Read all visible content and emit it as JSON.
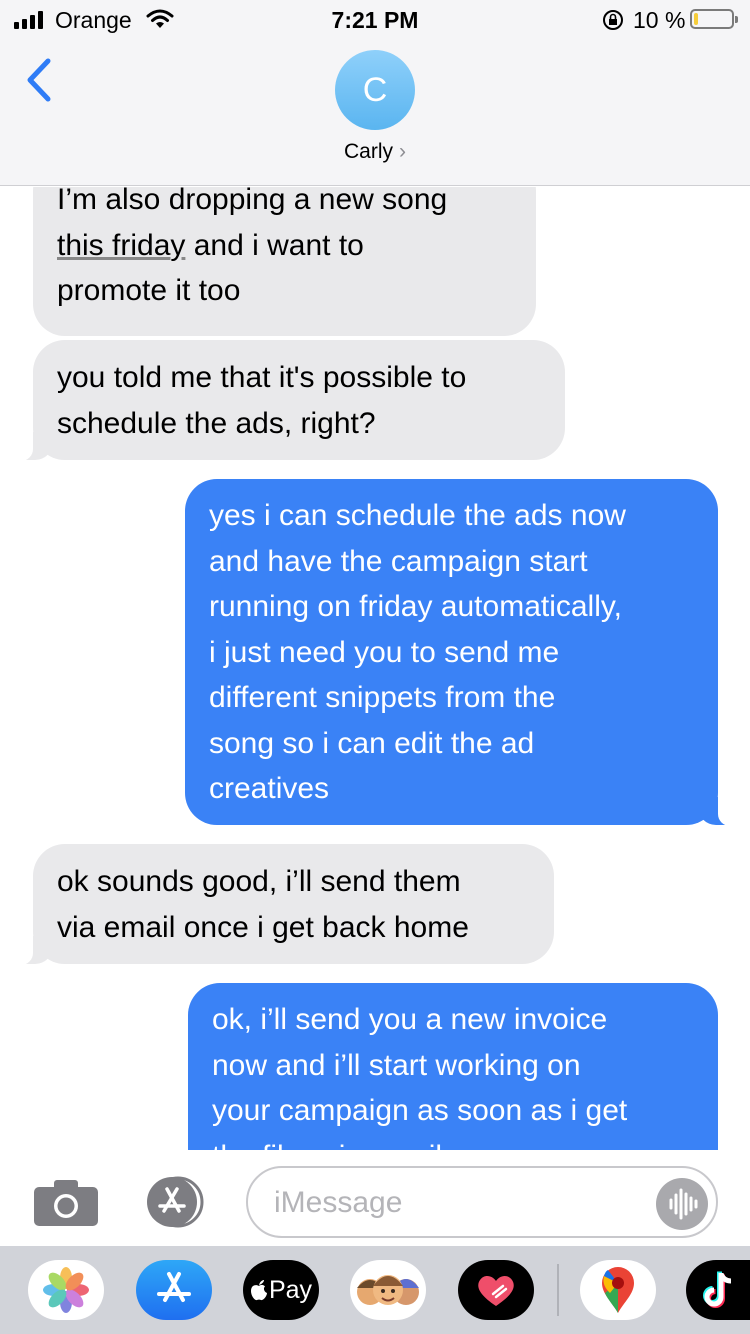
{
  "status_bar": {
    "carrier": "Orange",
    "time": "7:21 PM",
    "battery_percent": "10 %",
    "battery_level": 0.1,
    "icons": [
      "signal-icon",
      "wifi-icon",
      "orientation-lock-icon",
      "battery-icon"
    ]
  },
  "header": {
    "avatar_initial": "C",
    "contact_name": "Carly",
    "contact_chevron": "›",
    "icons": [
      "back-chevron-icon"
    ]
  },
  "messages": [
    {
      "sender": "contact",
      "lines": [
        "I’m also dropping a new song",
        "this friday and i want to",
        "promote it too"
      ],
      "underlined": "this friday"
    },
    {
      "sender": "contact",
      "lines": [
        "you told me that it's possible to",
        "schedule the ads, right?"
      ]
    },
    {
      "sender": "me",
      "lines": [
        "yes i can schedule the ads now",
        "and have the campaign start",
        "running on friday automatically,",
        "i just need you to send me",
        "different snippets from the",
        "song so i can edit the ad",
        "creatives"
      ]
    },
    {
      "sender": "contact",
      "lines": [
        "ok sounds good, i’ll send them",
        "via email once i get back home"
      ]
    },
    {
      "sender": "me",
      "lines": [
        "ok, i’ll send you a new invoice",
        "now and i’ll start working on",
        "your campaign as soon as i get",
        "the files via email"
      ]
    }
  ],
  "compose": {
    "placeholder": "iMessage",
    "icons": [
      "camera-icon",
      "app-store-icon",
      "audio-message-icon"
    ]
  },
  "app_drawer": {
    "apps": [
      {
        "name": "photos",
        "icon": "photos-icon"
      },
      {
        "name": "app-store",
        "icon": "app-store-icon"
      },
      {
        "name": "apple-pay",
        "icon": "apple-pay-icon",
        "label": "Pay"
      },
      {
        "name": "memoji",
        "icon": "memoji-icon"
      },
      {
        "name": "digital-touch",
        "icon": "digital-touch-heart-icon"
      },
      {
        "name": "google-maps",
        "icon": "google-maps-icon"
      },
      {
        "name": "tiktok",
        "icon": "tiktok-icon"
      }
    ]
  },
  "colors": {
    "outgoing_bubble": "#3a82f6",
    "incoming_bubble": "#e9e9eb",
    "accent": "#2f7cf6",
    "avatar": "#6cbef3"
  }
}
